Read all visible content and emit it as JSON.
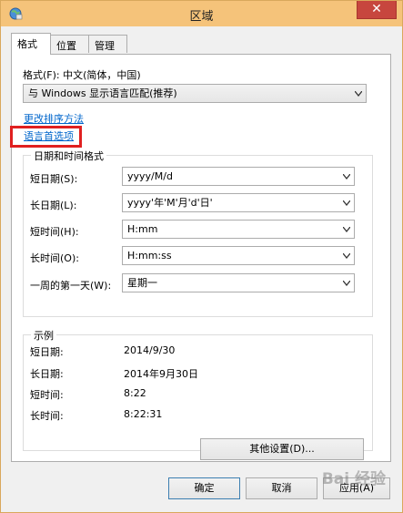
{
  "window": {
    "title": "区域",
    "close_symbol": "✕"
  },
  "tabs": [
    {
      "label": "格式",
      "active": true
    },
    {
      "label": "位置",
      "active": false
    },
    {
      "label": "管理",
      "active": false
    }
  ],
  "format": {
    "label": "格式(F): 中文(简体，中国)",
    "selected": "与 Windows 显示语言匹配(推荐)"
  },
  "links": {
    "change_sort": "更改排序方法",
    "language_prefs": "语言首选项"
  },
  "datetime_group": {
    "title": "日期和时间格式",
    "rows": [
      {
        "label": "短日期(S):",
        "value": "yyyy/M/d"
      },
      {
        "label": "长日期(L):",
        "value": "yyyy'年'M'月'd'日'"
      },
      {
        "label": "短时间(H):",
        "value": "H:mm"
      },
      {
        "label": "长时间(O):",
        "value": "H:mm:ss"
      },
      {
        "label": "一周的第一天(W):",
        "value": "星期一"
      }
    ]
  },
  "examples_group": {
    "title": "示例",
    "rows": [
      {
        "label": "短日期:",
        "value": "2014/9/30"
      },
      {
        "label": "长日期:",
        "value": "2014年9月30日"
      },
      {
        "label": "短时间:",
        "value": "8:22"
      },
      {
        "label": "长时间:",
        "value": "8:22:31"
      }
    ]
  },
  "buttons": {
    "other_settings": "其他设置(D)...",
    "ok": "确定",
    "cancel": "取消",
    "apply": "应用(A)"
  },
  "watermark": "Bai 经验"
}
